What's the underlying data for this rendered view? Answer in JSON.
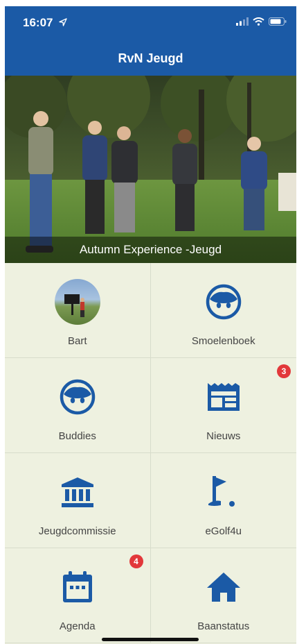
{
  "status_bar": {
    "time": "16:07"
  },
  "nav": {
    "title": "RvN Jeugd"
  },
  "hero": {
    "caption": "Autumn Experience -Jeugd"
  },
  "tiles": [
    {
      "label": "Bart",
      "icon": "avatar-photo"
    },
    {
      "label": "Smoelenboek",
      "icon": "face-icon"
    },
    {
      "label": "Buddies",
      "icon": "face-icon"
    },
    {
      "label": "Nieuws",
      "icon": "newspaper-icon",
      "badge": "3"
    },
    {
      "label": "Jeugdcommissie",
      "icon": "institution-icon"
    },
    {
      "label": "eGolf4u",
      "icon": "golf-flag-icon"
    },
    {
      "label": "Agenda",
      "icon": "calendar-icon",
      "badge": "4"
    },
    {
      "label": "Baanstatus",
      "icon": "home-icon"
    }
  ],
  "colors": {
    "primary": "#1b5aa6",
    "background": "#eef1e0",
    "badge": "#e2383a"
  }
}
